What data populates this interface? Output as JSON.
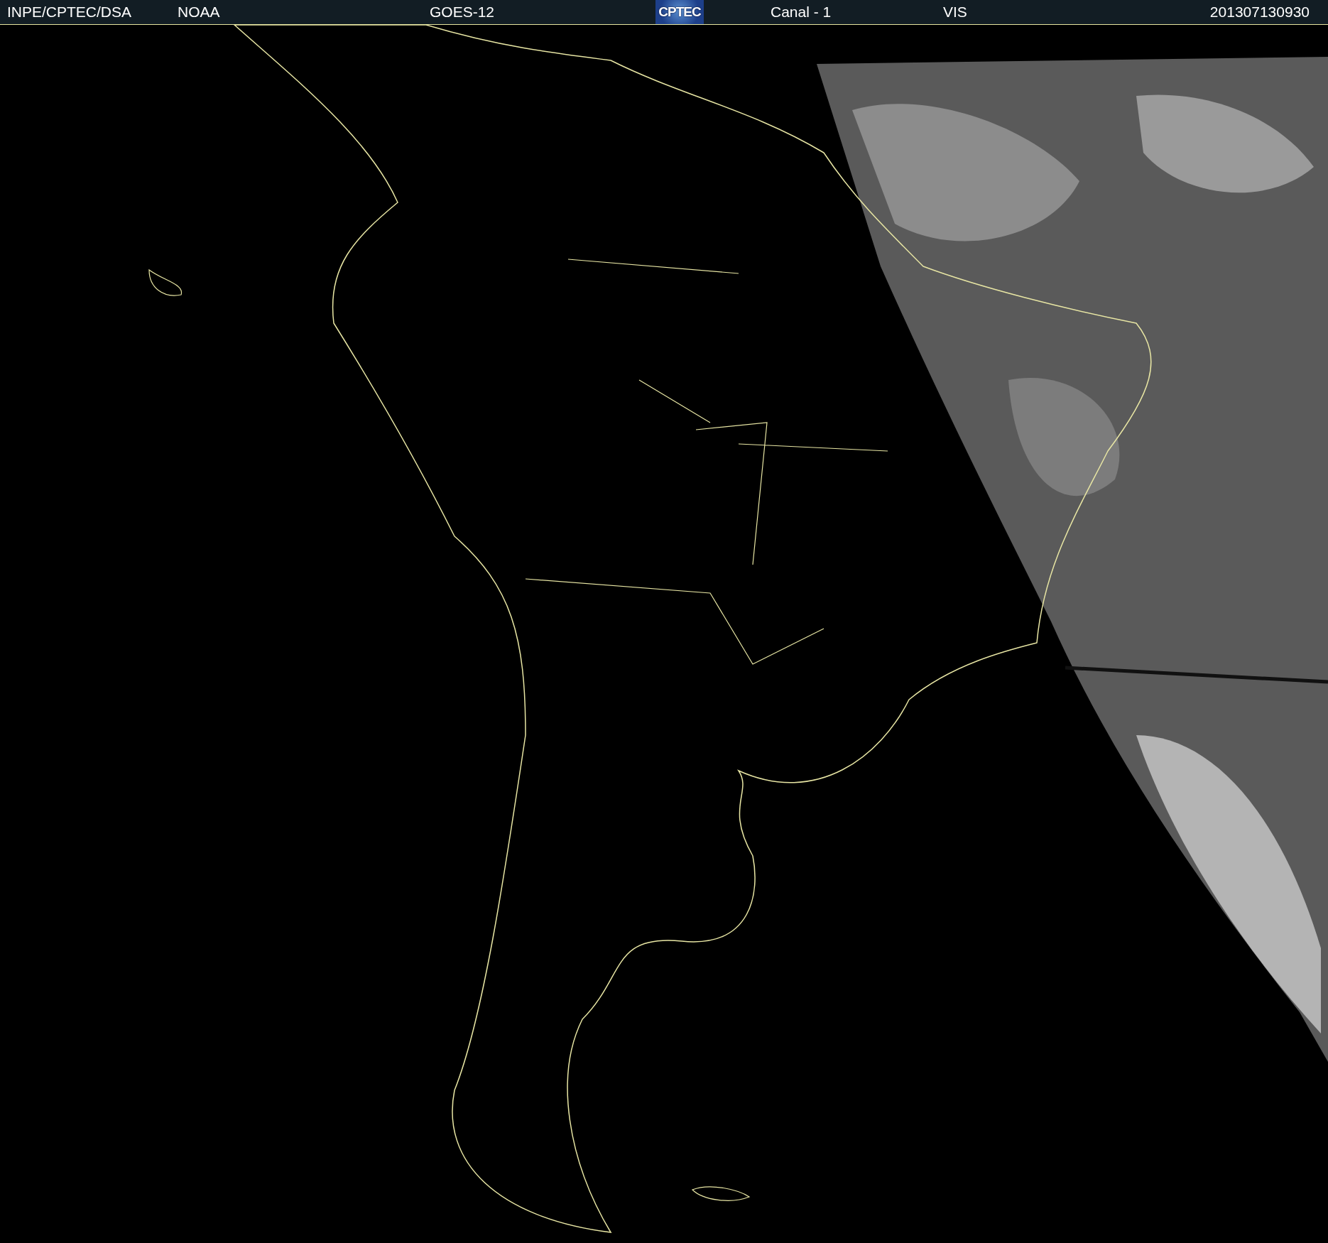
{
  "header": {
    "items": [
      {
        "kind": "text",
        "text": "INPE/CPTEC/DSA"
      },
      {
        "kind": "text",
        "text": "NOAA"
      },
      {
        "kind": "text",
        "text": "GOES-12"
      },
      {
        "kind": "logo",
        "text": "CPTEC"
      },
      {
        "kind": "text",
        "text": "Canal - 1"
      },
      {
        "kind": "text",
        "text": "VIS"
      },
      {
        "kind": "text",
        "text": "201307130930"
      }
    ]
  }
}
